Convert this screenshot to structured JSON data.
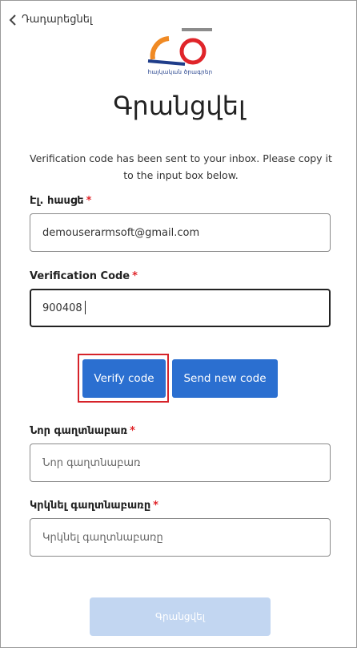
{
  "nav": {
    "back_label": "Դադարեցնել"
  },
  "brand": {
    "caption": "հայկական ծրագրեր",
    "colors": {
      "orange": "#f08a24",
      "red": "#e0252a",
      "blue": "#1f3d8a",
      "gray": "#8c8c8c"
    }
  },
  "page": {
    "title": "Գրանցվել"
  },
  "info": {
    "message": "Verification code has been sent to your inbox. Please copy it to the input box below."
  },
  "email": {
    "label": "Էլ. հասցե",
    "required_mark": "*",
    "value": "demouserarmsoft@gmail.com"
  },
  "verification": {
    "label": "Verification Code",
    "required_mark": "*",
    "value": "900408"
  },
  "buttons": {
    "verify_label": "Verify code",
    "send_label": "Send new code",
    "submit_label": "Գրանցվել"
  },
  "new_password": {
    "label": "Նոր գաղտնաբառ",
    "required_mark": "*",
    "placeholder": "Նոր գաղտնաբառ"
  },
  "confirm_password": {
    "label": "Կրկնել գաղտնաբառը",
    "required_mark": "*",
    "placeholder": "Կրկնել գաղտնաբառը"
  },
  "theme": {
    "primary": "#2b6fd0",
    "primary_disabled": "#c2d6f1",
    "highlight": "#d6232a"
  }
}
